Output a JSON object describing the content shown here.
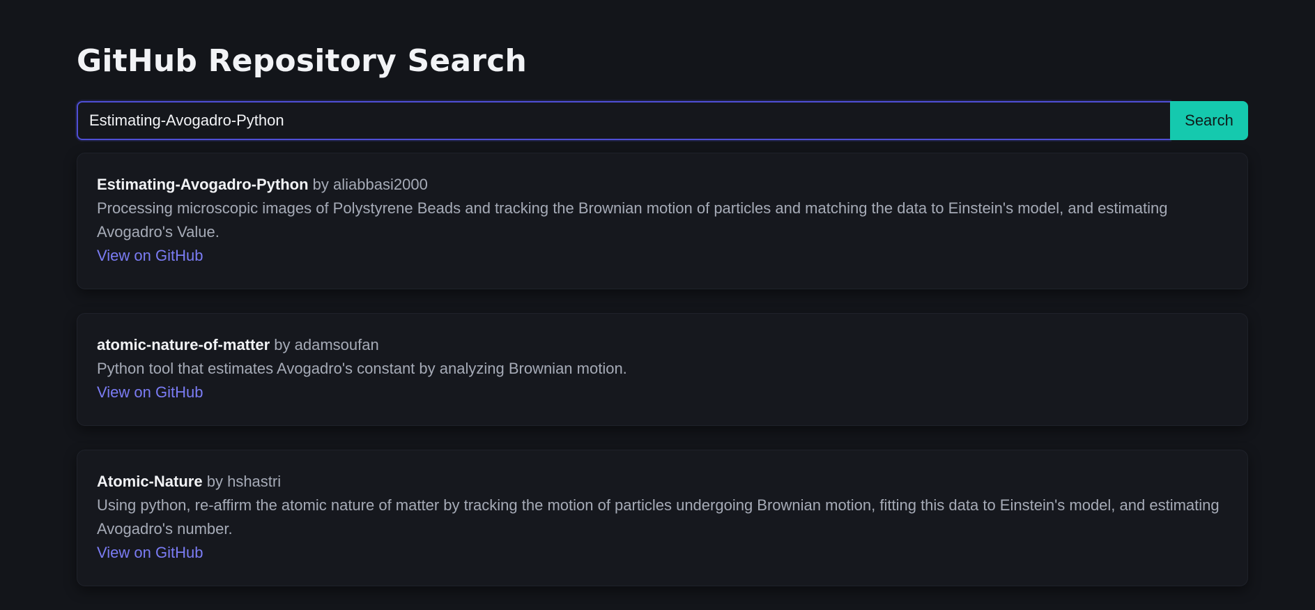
{
  "page": {
    "title": "GitHub Repository Search"
  },
  "search": {
    "value": "Estimating-Avogadro-Python",
    "button_label": "Search"
  },
  "results": [
    {
      "name": "Estimating-Avogadro-Python",
      "by": "by",
      "owner": "aliabbasi2000",
      "description": "Processing microscopic images of Polystyrene Beads and tracking the Brownian motion of particles and matching the data to Einstein's model, and estimating Avogadro's Value.",
      "link_label": "View on GitHub"
    },
    {
      "name": "atomic-nature-of-matter",
      "by": "by",
      "owner": "adamsoufan",
      "description": "Python tool that estimates Avogadro's constant by analyzing Brownian motion.",
      "link_label": "View on GitHub"
    },
    {
      "name": "Atomic-Nature",
      "by": "by",
      "owner": "hshastri",
      "description": "Using python, re-affirm the atomic nature of matter by tracking the motion of particles undergoing Brownian motion, fitting this data to Einstein's model, and estimating Avogadro's number.",
      "link_label": "View on GitHub"
    }
  ],
  "colors": {
    "background": "#13151a",
    "card": "#16181e",
    "accent_button": "#15c9ae",
    "link": "#7b7cf4",
    "input_border": "#4f4fd6"
  }
}
